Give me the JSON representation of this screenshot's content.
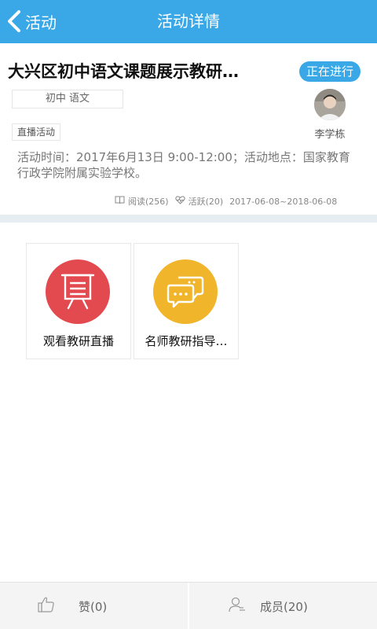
{
  "header": {
    "back_label": "活动",
    "title": "活动详情"
  },
  "activity": {
    "title": "大兴区初中语文课题展示教研…",
    "status": "正在进行",
    "subject": "初中 语文",
    "type": "直播活动",
    "author": "李学栋",
    "description": "活动时间：2017年6月13日 9:00-12:00；活动地点：国家教育行政学院附属实验学校。",
    "reads": "阅读(256)",
    "active": "活跃(20)",
    "date_range": "2017-06-08~2018-06-08"
  },
  "tiles": [
    {
      "label": "观看教研直播",
      "icon": "presentation-board-icon",
      "color": "#e24a50"
    },
    {
      "label": "名师教研指导…",
      "icon": "chat-bubbles-icon",
      "color": "#f0b52a"
    }
  ],
  "bottom": {
    "like_label": "赞(0)",
    "members_label": "成员(20)"
  },
  "colors": {
    "accent": "#3aa8e6",
    "divider": "#e6eef2"
  }
}
